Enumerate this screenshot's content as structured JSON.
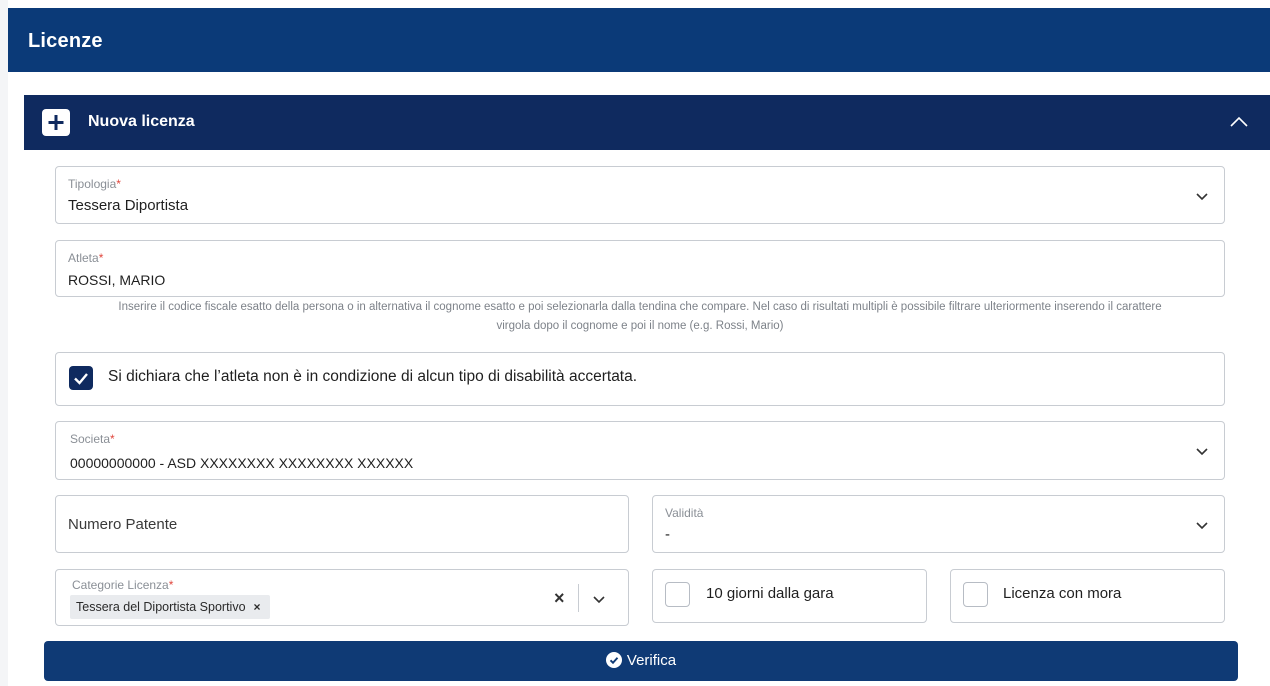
{
  "topbar": {
    "title": "Licenze"
  },
  "section": {
    "title": "Nuova licenza"
  },
  "tipologia": {
    "label": "Tipologia",
    "required_mark": "*",
    "value": "Tessera Diportista"
  },
  "atleta": {
    "label": "Atleta",
    "required_mark": "*",
    "value": "ROSSI, MARIO",
    "hint_line1": "Inserire il codice fiscale esatto della persona o in alternativa il cognome esatto e poi selezionarla dalla tendina che compare. Nel caso di risultati multipli è possibile filtrare ulteriormente inserendo il carattere",
    "hint_line2": "virgola dopo il cognome e poi il nome (e.g. Rossi, Mario)"
  },
  "disability_declaration": {
    "label": "Si dichiara che l’atleta non è in condizione di alcun tipo di disabilità accertata.",
    "checked": true
  },
  "societa": {
    "label": "Societa",
    "required_mark": "*",
    "value": "00000000000 - ASD XXXXXXXX XXXXXXXX XXXXXX"
  },
  "numero_patente": {
    "placeholder": "Numero Patente"
  },
  "validita": {
    "label": "Validità",
    "value": "-"
  },
  "categorie": {
    "label": "Categorie Licenza",
    "required_mark": "*",
    "tags": [
      "Tessera del Diportista Sportivo"
    ],
    "tag_remove": "×",
    "clear": "×"
  },
  "dieci_giorni": {
    "label": "10 giorni dalla gara",
    "checked": false
  },
  "mora": {
    "label": "Licenza con mora",
    "checked": false
  },
  "verify_button": {
    "label": "Verifica"
  },
  "colors": {
    "topbar": "#0b3a78",
    "section_header": "#0f2a5f",
    "button": "#0f3a75",
    "required": "#e0463d"
  },
  "icons": {
    "plus": "plus-icon",
    "collapse": "chevron-up-icon",
    "dropdown": "chevron-down-icon",
    "verify": "check-circle-icon"
  }
}
